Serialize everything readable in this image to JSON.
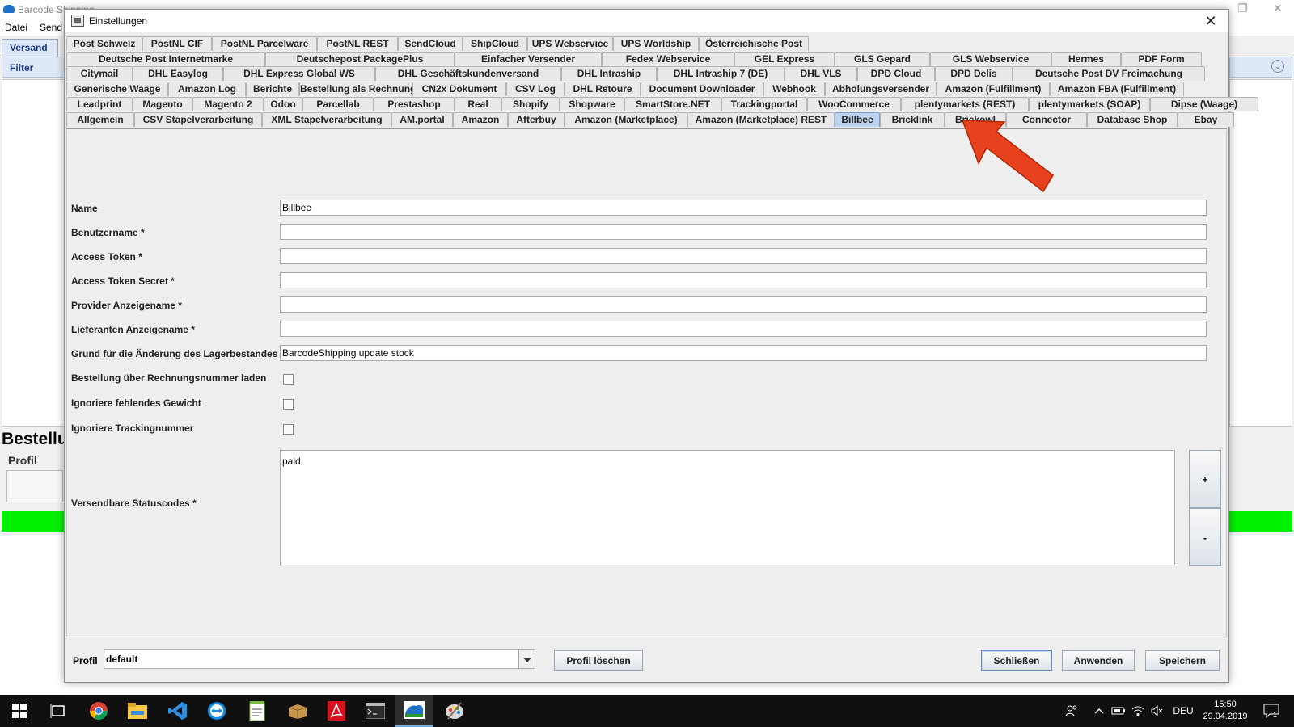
{
  "background_app": {
    "title": "Barcode Shipping",
    "menu": [
      "Datei",
      "Send"
    ],
    "tab_label": "Versand",
    "filter_label": "Filter",
    "heading": "Bestellu",
    "profil_label": "Profil"
  },
  "dialog": {
    "title": "Einstellungen",
    "tab_rows": [
      [
        "Post Schweiz",
        "PostNL CIF",
        "PostNL Parcelware",
        "PostNL REST",
        "SendCloud",
        "ShipCloud",
        "UPS Webservice",
        "UPS Worldship",
        "Österreichische Post"
      ],
      [
        "Deutsche Post Internetmarke",
        "Deutschepost PackagePlus",
        "Einfacher Versender",
        "Fedex Webservice",
        "GEL Express",
        "GLS Gepard",
        "GLS Webservice",
        "Hermes",
        "PDF Form"
      ],
      [
        "Citymail",
        "DHL Easylog",
        "DHL Express Global WS",
        "DHL Geschäftskundenversand",
        "DHL Intraship",
        "DHL Intraship 7 (DE)",
        "DHL VLS",
        "DPD Cloud",
        "DPD Delis",
        "Deutsche Post DV Freimachung"
      ],
      [
        "Generische Waage",
        "Amazon Log",
        "Berichte",
        "Bestellung als Rechnung",
        "CN2x Dokument",
        "CSV Log",
        "DHL Retoure",
        "Document Downloader",
        "Webhook",
        "Abholungsversender",
        "Amazon (Fulfillment)",
        "Amazon FBA (Fulfillment)"
      ],
      [
        "Leadprint",
        "Magento",
        "Magento 2",
        "Odoo",
        "Parcellab",
        "Prestashop",
        "Real",
        "Shopify",
        "Shopware",
        "SmartStore.NET",
        "Trackingportal",
        "WooCommerce",
        "plentymarkets (REST)",
        "plentymarkets (SOAP)",
        "Dipse (Waage)"
      ],
      [
        "Allgemein",
        "CSV Stapelverarbeitung",
        "XML Stapelverarbeitung",
        "AM.portal",
        "Amazon",
        "Afterbuy",
        "Amazon (Marketplace)",
        "Amazon (Marketplace) REST",
        "Billbee",
        "Bricklink",
        "Brickowl",
        "Connector",
        "Database Shop",
        "Ebay"
      ]
    ],
    "active_tab": "Billbee",
    "fields": {
      "name": {
        "label": "Name",
        "value": "Billbee"
      },
      "username": {
        "label": "Benutzername *",
        "value": ""
      },
      "access_token": {
        "label": "Access Token *",
        "value": ""
      },
      "access_token_secret": {
        "label": "Access Token Secret *",
        "value": ""
      },
      "provider_name": {
        "label": "Provider Anzeigename *",
        "value": ""
      },
      "supplier_name": {
        "label": "Lieferanten Anzeigename *",
        "value": ""
      },
      "stock_reason": {
        "label": "Grund für die Änderung des Lagerbestandes",
        "value": "BarcodeShipping update stock"
      }
    },
    "checkboxes": {
      "load_by_invoice": {
        "label": "Bestellung über Rechnungsnummer laden",
        "checked": false
      },
      "ignore_weight": {
        "label": "Ignoriere fehlendes Gewicht",
        "checked": false
      },
      "ignore_tracking": {
        "label": "Ignoriere Trackingnummer",
        "checked": false
      }
    },
    "status_codes": {
      "label": "Versendbare Statuscodes *",
      "value": "paid",
      "add": "+",
      "remove": "-"
    },
    "footer": {
      "profile_label": "Profil",
      "profile_value": "default",
      "delete_profile": "Profil löschen",
      "close": "Schließen",
      "apply": "Anwenden",
      "save": "Speichern"
    }
  },
  "taskbar": {
    "apps": [
      "windows-start-icon",
      "task-view-icon",
      "chrome-icon",
      "file-explorer-icon",
      "vscode-icon",
      "teamviewer-icon",
      "notepad-icon",
      "package-icon",
      "acrobat-icon",
      "terminal-icon",
      "barcode-shipping-icon",
      "paint-icon"
    ],
    "language": "DEU",
    "time": "15:50",
    "date": "29.04.2019",
    "notification_count": "1"
  },
  "colors": {
    "active_tab": "#bdd3f0",
    "arrow": "#e8411d",
    "status_green": "#00f000"
  }
}
